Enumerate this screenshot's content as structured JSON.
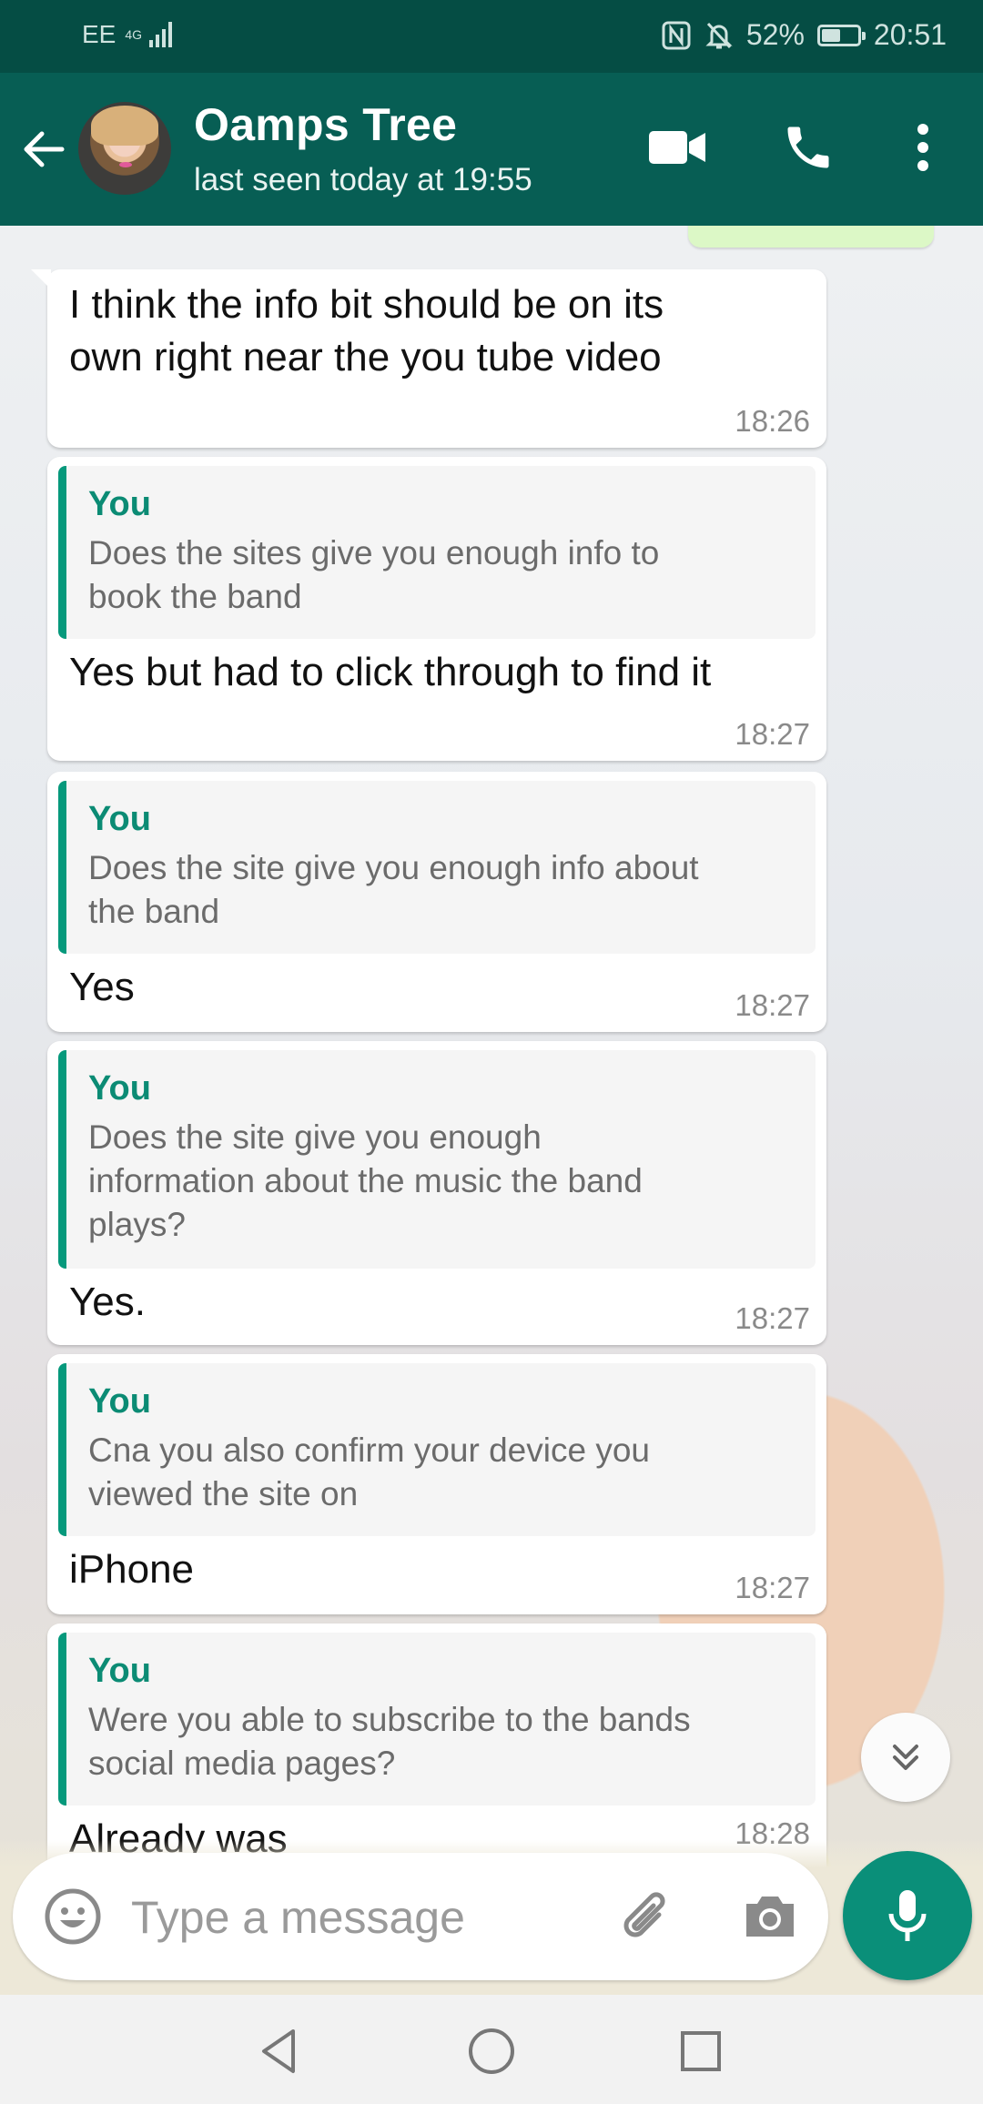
{
  "status_bar": {
    "carrier": "EE",
    "network": "4G",
    "battery": "52%",
    "battery_level": 0.52,
    "time": "20:51"
  },
  "header": {
    "contact_name": "Oamps Tree",
    "last_seen": "last seen today at 19:55",
    "icons": [
      "back-arrow-icon",
      "video-call-icon",
      "voice-call-icon",
      "more-options-icon"
    ]
  },
  "messages": [
    {
      "text_lines": [
        "I think the info bit should be on its",
        "own right near the you tube video"
      ],
      "time": "18:26"
    },
    {
      "quote_author": "You",
      "quote_lines": [
        "Does the sites give you enough info to",
        "book the band"
      ],
      "text": "Yes but had to click through to find it",
      "time": "18:27"
    },
    {
      "quote_author": "You",
      "quote_lines": [
        "Does the site give you enough info about",
        "the band"
      ],
      "text": "Yes",
      "time": "18:27"
    },
    {
      "quote_author": "You",
      "quote_lines": [
        "Does the site give you enough",
        "information about the music the band",
        "plays?"
      ],
      "text": "Yes.",
      "time": "18:27"
    },
    {
      "quote_author": "You",
      "quote_lines": [
        "Cna you also confirm your device you",
        "viewed the site on"
      ],
      "text": "iPhone",
      "time": "18:27"
    },
    {
      "quote_author": "You",
      "quote_lines": [
        "Were you able to subscribe to the bands",
        "social media pages?"
      ],
      "text": "Already was",
      "time": "18:28"
    }
  ],
  "composer": {
    "placeholder": "Type a message"
  },
  "colors": {
    "status_bar": "#054d44",
    "app_bar": "#075e54",
    "accent": "#0a8f79",
    "quote_author": "#0b8b74",
    "outgoing_bubble": "#dcf8c6"
  }
}
